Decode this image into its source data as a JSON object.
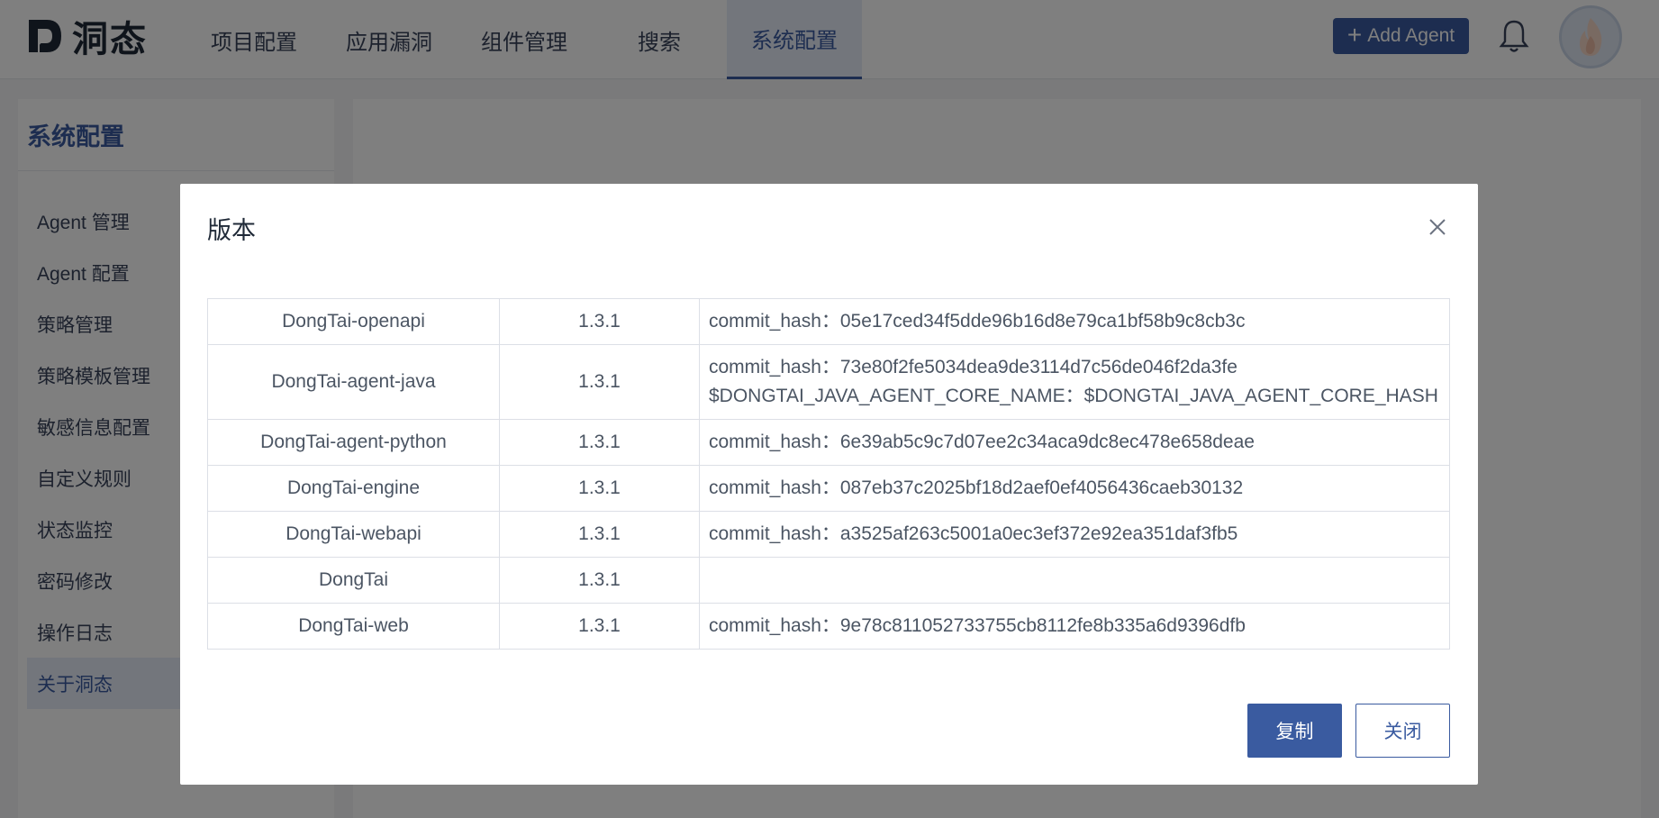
{
  "header": {
    "logo_text": "洞态",
    "nav": [
      {
        "label": "项目配置"
      },
      {
        "label": "应用漏洞"
      },
      {
        "label": "组件管理"
      },
      {
        "label": "搜索"
      },
      {
        "label": "系统配置",
        "active": true
      }
    ],
    "add_agent_label": "Add Agent",
    "icons": {
      "add": "plus-icon",
      "bell": "bell-icon",
      "avatar": "flame-avatar-icon"
    }
  },
  "sidebar": {
    "title": "系统配置",
    "items": [
      {
        "label": "Agent 管理"
      },
      {
        "label": "Agent 配置"
      },
      {
        "label": "策略管理"
      },
      {
        "label": "策略模板管理"
      },
      {
        "label": "敏感信息配置"
      },
      {
        "label": "自定义规则"
      },
      {
        "label": "状态监控"
      },
      {
        "label": "密码修改"
      },
      {
        "label": "操作日志"
      },
      {
        "label": "关于洞态",
        "active": true
      }
    ]
  },
  "modal": {
    "title": "版本",
    "close_icon": "close-icon",
    "rows": [
      {
        "name": "DongTai-openapi",
        "version": "1.3.1",
        "hash_lines": [
          "commit_hash：05e17ced34f5dde96b16d8e79ca1bf58b9c8cb3c"
        ]
      },
      {
        "name": "DongTai-agent-java",
        "version": "1.3.1",
        "hash_lines": [
          "commit_hash：73e80f2fe5034dea9de3114d7c56de046f2da3fe",
          "$DONGTAI_JAVA_AGENT_CORE_NAME：$DONGTAI_JAVA_AGENT_CORE_HASH"
        ]
      },
      {
        "name": "DongTai-agent-python",
        "version": "1.3.1",
        "hash_lines": [
          "commit_hash：6e39ab5c9c7d07ee2c34aca9dc8ec478e658deae"
        ]
      },
      {
        "name": "DongTai-engine",
        "version": "1.3.1",
        "hash_lines": [
          "commit_hash：087eb37c2025bf18d2aef0ef4056436caeb30132"
        ]
      },
      {
        "name": "DongTai-webapi",
        "version": "1.3.1",
        "hash_lines": [
          "commit_hash：a3525af263c5001a0ec3ef372e92ea351daf3fb5"
        ]
      },
      {
        "name": "DongTai",
        "version": "1.3.1",
        "hash_lines": [
          ""
        ]
      },
      {
        "name": "DongTai-web",
        "version": "1.3.1",
        "hash_lines": [
          "commit_hash：9e78c811052733755cb8112fe8b335a6d9396dfb"
        ]
      }
    ],
    "copy_label": "复制",
    "close_label": "关闭"
  },
  "colors": {
    "accent": "#3a5ba0",
    "active_bg": "#e6edf9",
    "overlay": "rgba(0,0,0,0.5)"
  }
}
